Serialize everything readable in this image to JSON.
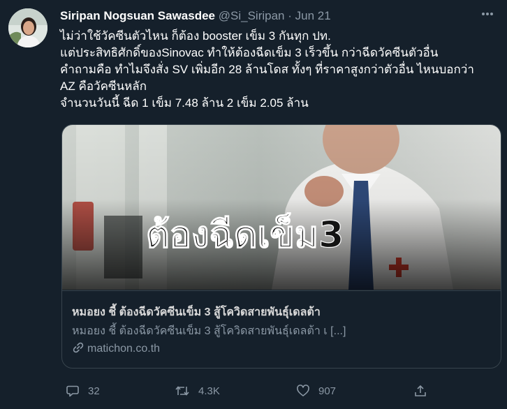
{
  "tweet": {
    "author_name": "Siripan Nogsuan Sawasdee",
    "handle": "@Si_Siripan",
    "separator": "·",
    "date": "Jun 21",
    "lines": [
      "ไม่ว่าใช้วัคซีนตัวไหน ก็ต้อง booster เข็ม 3 กันทุก ปท.",
      "แต่ประสิทธิศักดิ์ของSinovac ทำให้ต้องฉีดเข็ม 3 เร็วขึ้น กว่าฉีดวัคซีนตัวอื่น",
      "คำถามคือ ทำไมจึงสั่ง SV เพิ่มอีก 28 ล้านโดส ทั้งๆ ที่ราคาสูงกว่าตัวอื่น ไหนบอกว่า",
      "AZ คือวัคซีนหลัก",
      "จำนวนวันนี้ ฉีด 1 เข็ม 7.48 ล้าน 2 เข็ม 2.05 ล้าน"
    ]
  },
  "card": {
    "image_overlay_text": "ต้องฉีดเข็ม3",
    "title": "หมอยง ชี้ ต้องฉีดวัคซีนเข็ม 3 สู้โควิดสายพันธุ์เดลต้า",
    "description": "หมอยง ชี้ ต้องฉีดวัคซีนเข็ม 3 สู้โควิดสายพันธุ์เดลต้า เ [...]",
    "domain": "matichon.co.th"
  },
  "actions": {
    "replies": "32",
    "retweets": "4.3K",
    "likes": "907"
  },
  "icons": {
    "more": "more-icon",
    "reply": "reply-icon",
    "retweet": "retweet-icon",
    "like": "heart-icon",
    "share": "share-icon",
    "link": "link-icon"
  },
  "colors": {
    "background": "#15202b",
    "secondary_text": "#8b98a5",
    "border": "#38444d"
  }
}
